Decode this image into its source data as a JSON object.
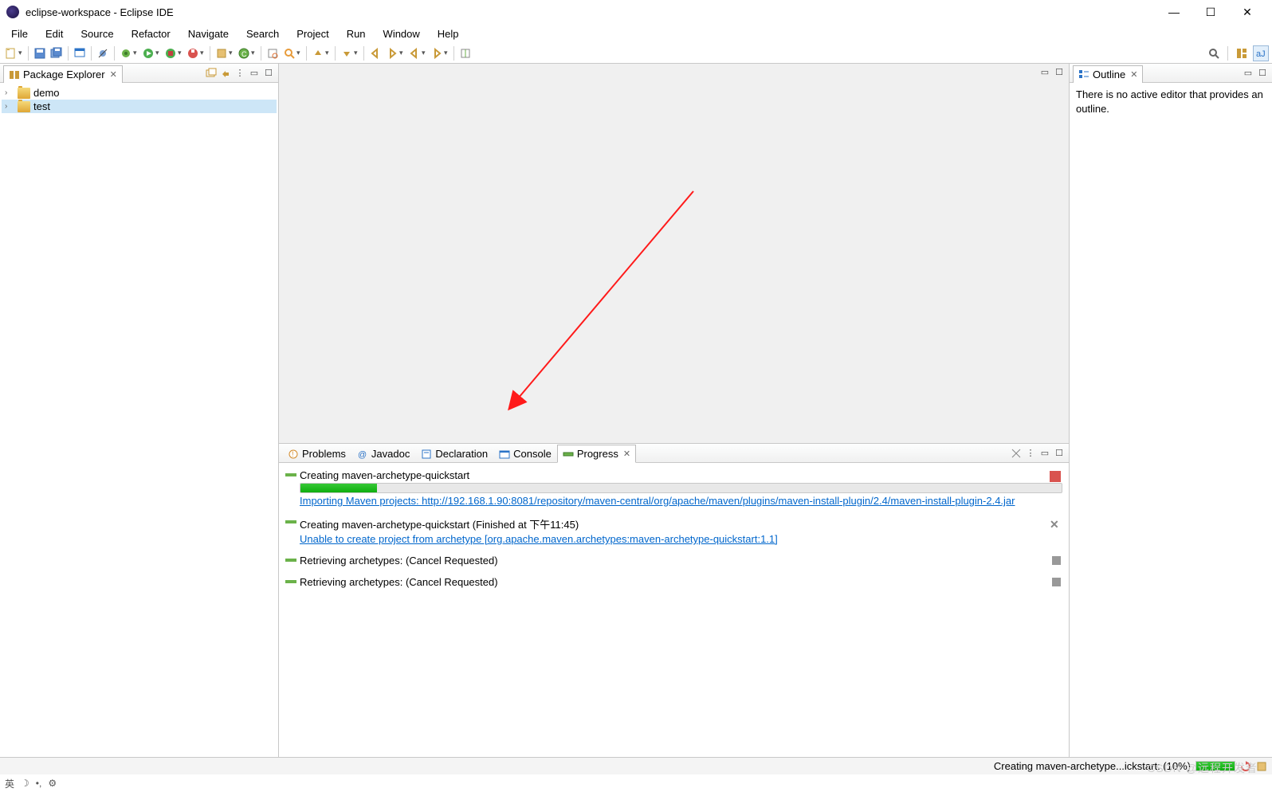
{
  "window": {
    "title": "eclipse-workspace - Eclipse IDE"
  },
  "menu": {
    "items": [
      "File",
      "Edit",
      "Source",
      "Refactor",
      "Navigate",
      "Search",
      "Project",
      "Run",
      "Window",
      "Help"
    ]
  },
  "left": {
    "view_title": "Package Explorer",
    "tree": [
      {
        "label": "demo",
        "selected": false
      },
      {
        "label": "test",
        "selected": true
      }
    ]
  },
  "right": {
    "view_title": "Outline",
    "body": "There is no active editor that provides an outline."
  },
  "bottom": {
    "tabs": [
      {
        "label": "Problems"
      },
      {
        "label": "Javadoc"
      },
      {
        "label": "Declaration"
      },
      {
        "label": "Console"
      },
      {
        "label": "Progress"
      }
    ],
    "items": [
      {
        "title": "Creating maven-archetype-quickstart",
        "progress_pct": 10,
        "link": "Importing Maven projects: http://192.168.1.90:8081/repository/maven-central/org/apache/maven/plugins/maven-install-plugin/2.4/maven-install-plugin-2.4.jar",
        "action": "stop"
      },
      {
        "title": "Creating maven-archetype-quickstart (Finished at 下午11:45)",
        "link": "Unable to create project from archetype [org.apache.maven.archetypes:maven-archetype-quickstart:1.1]",
        "action": "close"
      },
      {
        "title": "Retrieving archetypes: (Cancel Requested)",
        "action": "grey"
      },
      {
        "title": "Retrieving archetypes: (Cancel Requested)",
        "action": "grey"
      }
    ]
  },
  "status": {
    "text": "Creating maven-archetype...ickstart: (10%)"
  },
  "watermark": "CSDN @远程开发者",
  "osbar": {
    "ime": "英"
  }
}
